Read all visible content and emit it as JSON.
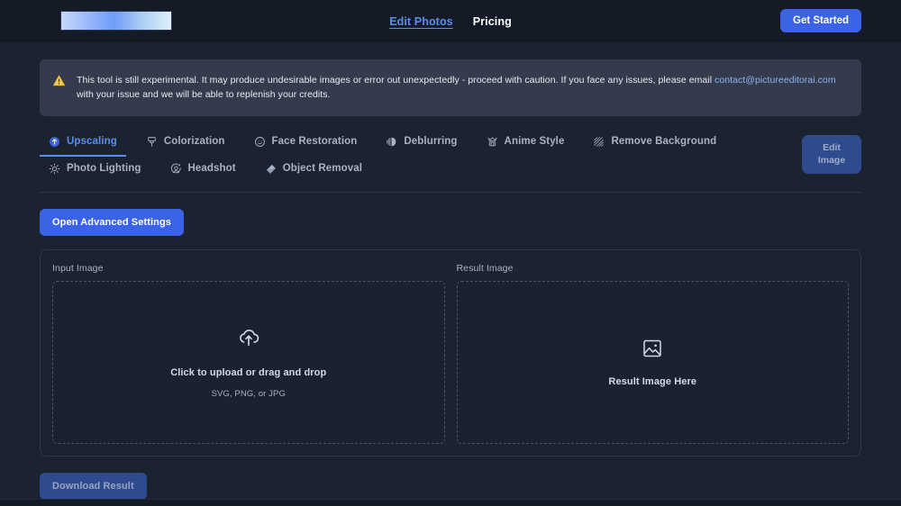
{
  "header": {
    "logo_alt": "picture-editor-ai-logo",
    "nav": [
      {
        "label": "Edit Photos",
        "active": true
      },
      {
        "label": "Pricing",
        "active": false
      }
    ],
    "cta_label": "Get Started"
  },
  "banner": {
    "icon": "warning-triangle-icon",
    "text_before": "This tool is still experimental. It may produce undesirable images or error out unexpectedly - proceed with caution. If you face any issues, please email ",
    "email": "contact@pictureeditorai.com",
    "text_after": " with your issue and we will be able to replenish your credits."
  },
  "tabs": [
    {
      "label": "Upscaling",
      "icon": "upscale-arrow-icon",
      "active": true
    },
    {
      "label": "Colorization",
      "icon": "paint-brush-icon",
      "active": false
    },
    {
      "label": "Face Restoration",
      "icon": "smiley-face-icon",
      "active": false
    },
    {
      "label": "Deblurring",
      "icon": "blur-contrast-icon",
      "active": false
    },
    {
      "label": "Anime Style",
      "icon": "anime-sparkle-icon",
      "active": false
    },
    {
      "label": "Remove Background",
      "icon": "diagonal-hatch-icon",
      "active": false
    },
    {
      "label": "Photo Lighting",
      "icon": "sun-brightness-icon",
      "active": false
    },
    {
      "label": "Headshot",
      "icon": "portrait-avatar-icon",
      "active": false
    },
    {
      "label": "Object Removal",
      "icon": "eraser-icon",
      "active": false
    }
  ],
  "edit_image_button": {
    "line1": "Edit",
    "line2": "Image"
  },
  "advanced_settings_button": {
    "label": "Open Advanced Settings"
  },
  "panel": {
    "input": {
      "label": "Input Image",
      "icon": "cloud-upload-icon",
      "primary": "Click to upload or drag and drop",
      "secondary": "SVG, PNG, or JPG"
    },
    "result": {
      "label": "Result Image",
      "icon": "image-placeholder-icon",
      "text": "Result Image Here"
    }
  },
  "download_button": {
    "label": "Download Result"
  },
  "colors": {
    "page_background": "#1b2230",
    "header_background": "#141a26",
    "accent_blue": "#3b63e8",
    "active_tab_blue": "#5b8def",
    "muted_button_blue": "#2f4a8f",
    "banner_background": "#333b4c",
    "warning_amber": "#f2c94c",
    "link_blue": "#8fb2f5"
  }
}
